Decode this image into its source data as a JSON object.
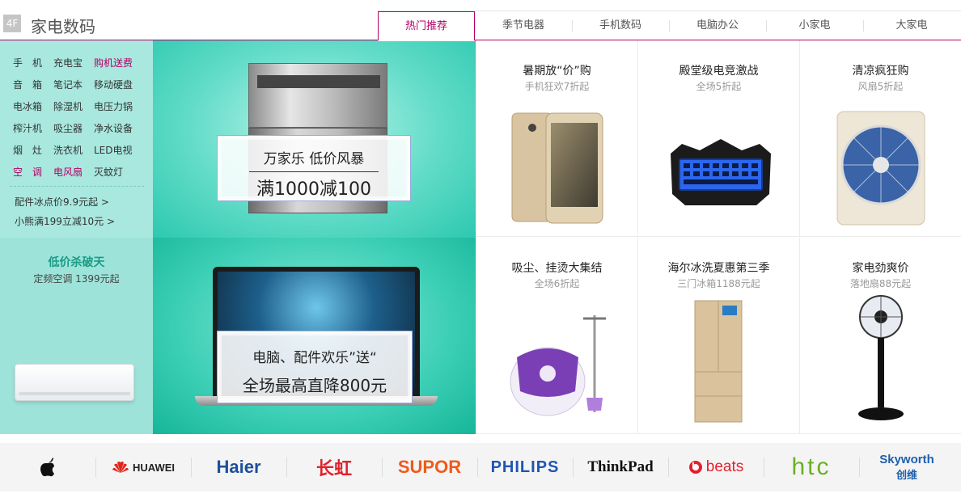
{
  "floor": {
    "badge": "4F",
    "title": "家电数码"
  },
  "tabs": [
    "热门推荐",
    "季节电器",
    "手机数码",
    "电脑办公",
    "小家电",
    "大家电"
  ],
  "categories": [
    [
      {
        "t": "手　机",
        "hot": false
      },
      {
        "t": "充电宝",
        "hot": false
      },
      {
        "t": "购机送费",
        "hot": true
      }
    ],
    [
      {
        "t": "音　箱",
        "hot": false
      },
      {
        "t": "笔记本",
        "hot": false
      },
      {
        "t": "移动硬盘",
        "hot": false
      }
    ],
    [
      {
        "t": "电冰箱",
        "hot": false
      },
      {
        "t": "除湿机",
        "hot": false
      },
      {
        "t": "电压力锅",
        "hot": false
      }
    ],
    [
      {
        "t": "榨汁机",
        "hot": false
      },
      {
        "t": "吸尘器",
        "hot": false
      },
      {
        "t": "净水设备",
        "hot": false
      }
    ],
    [
      {
        "t": "烟　灶",
        "hot": false
      },
      {
        "t": "洗衣机",
        "hot": false
      },
      {
        "t": "LED电视",
        "hot": false
      }
    ],
    [
      {
        "t": "空　调",
        "hot": true
      },
      {
        "t": "电风扇",
        "hot": true
      },
      {
        "t": "灭蚊灯",
        "hot": false
      }
    ]
  ],
  "promos": [
    "配件冰点价9.9元起 >",
    "小熊满199立减10元 >"
  ],
  "left_card": {
    "title": "低价杀破天",
    "subtitle": "定频空调 1399元起"
  },
  "banner1": {
    "line1": "万家乐 低价风暴",
    "line2": "满1000减100"
  },
  "banner2": {
    "line1": "电脑、配件欢乐”送“",
    "line2": "全场最高直降800元"
  },
  "products": [
    {
      "title": "暑期放“价”购",
      "sub": "手机狂欢7折起"
    },
    {
      "title": "殿堂级电竞激战",
      "sub": "全场5折起"
    },
    {
      "title": "清凉疯狂购",
      "sub": "风扇5折起"
    },
    {
      "title": "吸尘、挂烫大集结",
      "sub": "全场6折起"
    },
    {
      "title": "海尔冰洗夏惠第三季",
      "sub": "三门冰箱1188元起"
    },
    {
      "title": "家电劲爽价",
      "sub": "落地扇88元起"
    }
  ],
  "brands": [
    "",
    "HUAWEI",
    "Haier",
    "长虹",
    "SUPOR",
    "PHILIPS",
    "ThinkPad",
    "beats",
    "htc",
    "Skyworth",
    "创维"
  ],
  "colors": {
    "accent": "#b40066",
    "mint": "#a8e8df",
    "teal_title": "#199c86"
  }
}
